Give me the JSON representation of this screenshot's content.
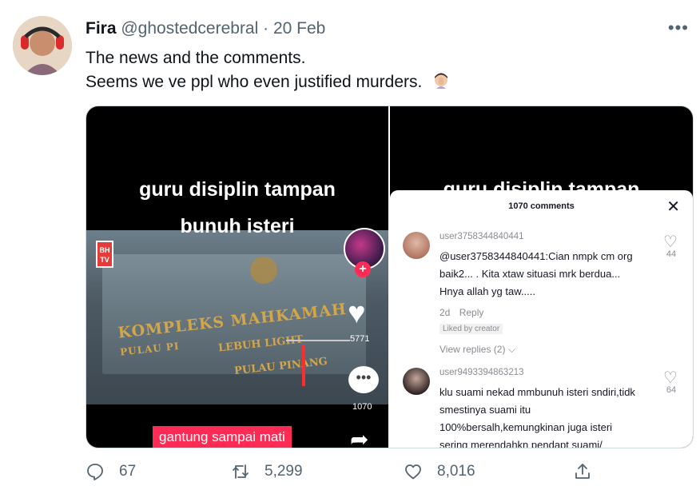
{
  "tweet": {
    "name": "Fira",
    "handle": "@ghostedcerebral",
    "separator": "·",
    "date": "20 Feb",
    "more_label": "•••",
    "line1": "The news and the comments.",
    "line2": "Seems we ve ppl who even justified murders."
  },
  "left_media": {
    "title_line1": "guru disiplin tampan",
    "title_line2": "bunuh isteri",
    "logo_text": "BH TV",
    "court_line1": "KOMPLEKS MAHKAMAH",
    "court_line1b": "PULAU PI",
    "court_line2": "LEBUH LIGHT",
    "court_line3": "PULAU PINANG",
    "like_count": "5771",
    "comment_count": "1070",
    "caption": "gantung sampai mati"
  },
  "right_media": {
    "title_partial": "guru disiplin tampan",
    "sheet_title": "1070 comments",
    "close_label": "✕",
    "comments": [
      {
        "user": "user3758344840441",
        "text": "@user3758344840441:Cian nmpk cm org baik2... . Kita xtaw situasi mrk berdua... Hnya allah yg taw.....",
        "likes": "44",
        "time": "2d",
        "reply_label": "Reply",
        "liked_by": "Liked by creator",
        "view_replies": "View replies (2)"
      },
      {
        "user": "user9493394863213",
        "text": "klu suami nekad mmbunuh isteri sndiri,tidk smestinya suami itu 100%bersalh,kemungkinan juga isteri sering merendahkn pendapt suami/",
        "likes": "64"
      }
    ]
  },
  "actions": {
    "replies": "67",
    "retweets": "5,299",
    "likes": "8,016"
  },
  "colors": {
    "text_primary": "#0f1419",
    "text_secondary": "#536471",
    "tiktok_red": "#fe2c55"
  }
}
